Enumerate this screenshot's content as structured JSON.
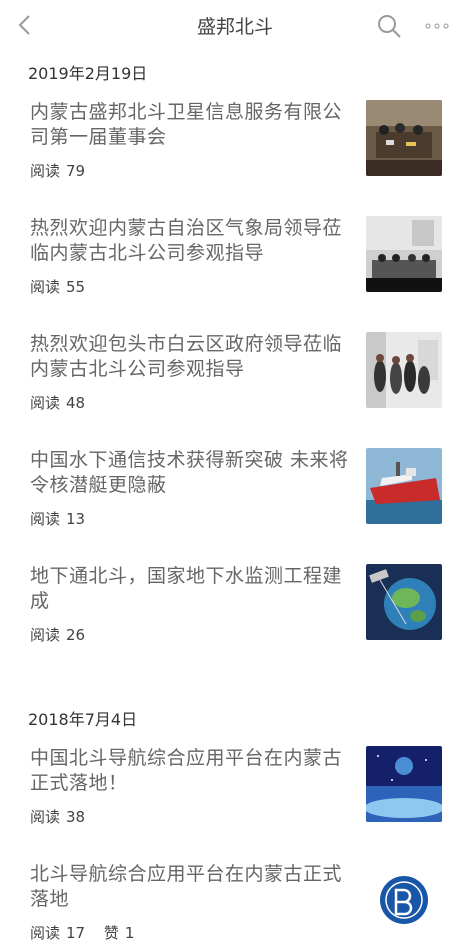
{
  "header": {
    "title": "盛邦北斗",
    "back_icon": "chevron-left-icon",
    "search_icon": "search-icon",
    "more_icon": "more-dots-icon"
  },
  "groups": [
    {
      "date": "2019年2月19日",
      "items": [
        {
          "title": "内蒙古盛邦北斗卫星信息服务有限公司第一届董事会",
          "read_label": "阅读",
          "reads": "79"
        },
        {
          "title": "热烈欢迎内蒙古自治区气象局领导莅临内蒙古北斗公司参观指导",
          "read_label": "阅读",
          "reads": "55"
        },
        {
          "title": "热烈欢迎包头市白云区政府领导莅临内蒙古北斗公司参观指导",
          "read_label": "阅读",
          "reads": "48"
        },
        {
          "title": "中国水下通信技术获得新突破 未来将令核潜艇更隐蔽",
          "read_label": "阅读",
          "reads": "13"
        },
        {
          "title": "地下通北斗，国家地下水监测工程建成",
          "read_label": "阅读",
          "reads": "26"
        }
      ]
    },
    {
      "date": "2018年7月4日",
      "items": [
        {
          "title": "中国北斗导航综合应用平台在内蒙古正式落地！",
          "read_label": "阅读",
          "reads": "38"
        },
        {
          "title": "北斗导航综合应用平台在内蒙古正式落地",
          "read_label": "阅读",
          "reads": "17",
          "like_label": "赞",
          "likes": "1"
        }
      ]
    }
  ]
}
